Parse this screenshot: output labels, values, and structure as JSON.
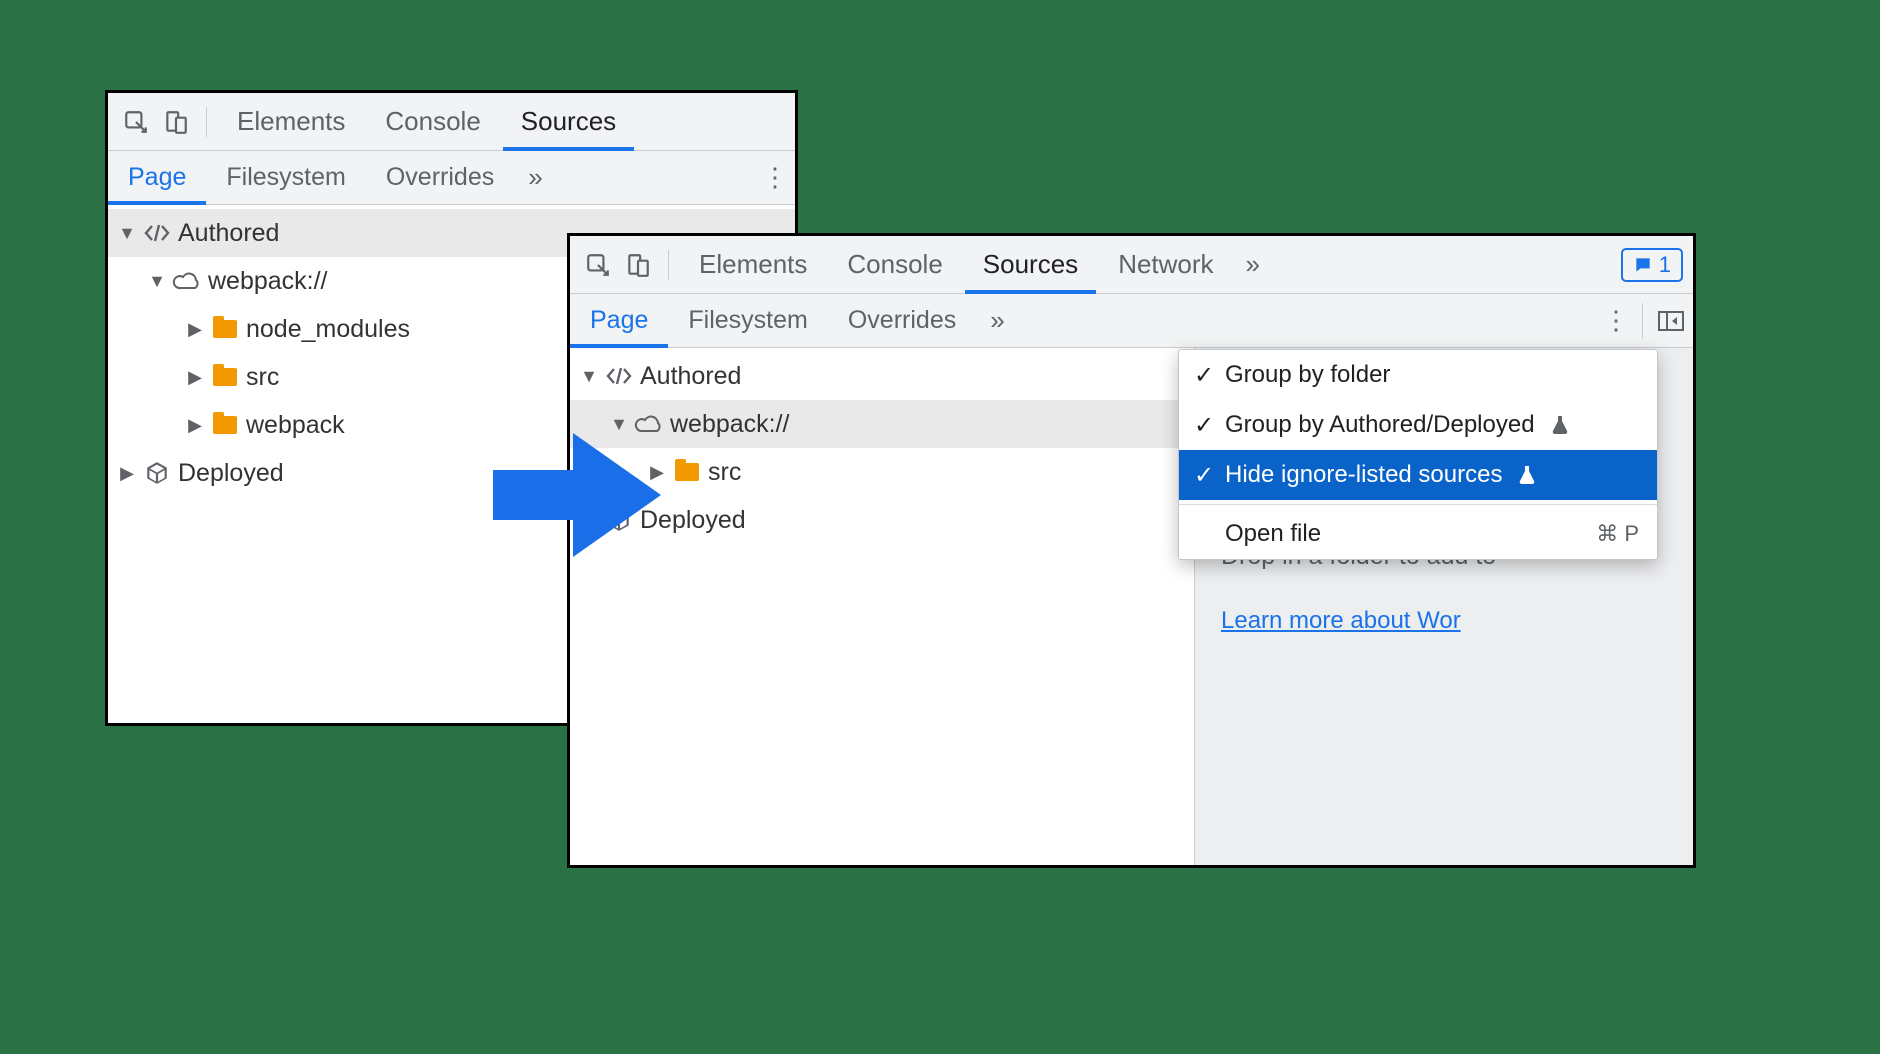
{
  "left": {
    "tabs": {
      "elements": "Elements",
      "console": "Console",
      "sources": "Sources"
    },
    "subtabs": {
      "page": "Page",
      "filesystem": "Filesystem",
      "overrides": "Overrides"
    },
    "tree": {
      "authored": "Authored",
      "webpack": "webpack://",
      "node_modules": "node_modules",
      "src": "src",
      "webpack_folder": "webpack",
      "deployed": "Deployed"
    }
  },
  "right": {
    "tabs": {
      "elements": "Elements",
      "console": "Console",
      "sources": "Sources",
      "network": "Network"
    },
    "badge_count": "1",
    "subtabs": {
      "page": "Page",
      "filesystem": "Filesystem",
      "overrides": "Overrides"
    },
    "tree": {
      "authored": "Authored",
      "webpack": "webpack://",
      "src": "src",
      "deployed": "Deployed"
    },
    "menu": {
      "group_folder": "Group by folder",
      "group_auth": "Group by Authored/Deployed",
      "hide_ignore": "Hide ignore-listed sources",
      "open_file": "Open file",
      "open_file_shortcut": "⌘ P"
    },
    "drop": {
      "hint": "Drop in a folder to add to",
      "learn": "Learn more about Wor"
    }
  }
}
